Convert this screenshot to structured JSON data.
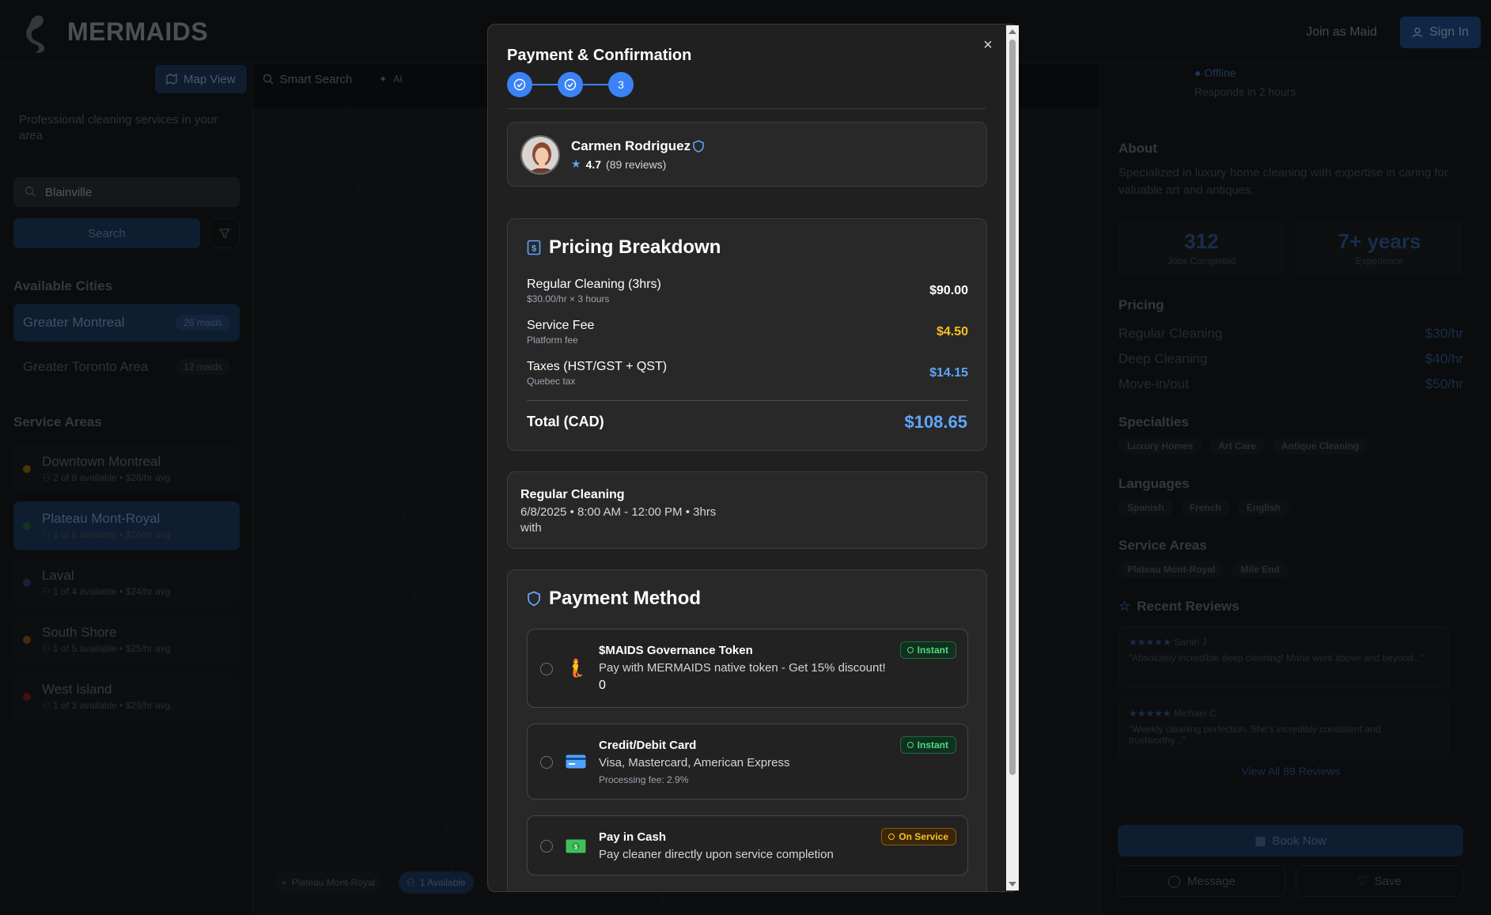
{
  "app": {
    "brand": "MERMAIDS",
    "join_label": "Join as Maid",
    "signin_label": "Sign In"
  },
  "view_tabs": [
    {
      "label": "Map View"
    },
    {
      "label": "Smart Search"
    },
    {
      "label": "AI"
    }
  ],
  "sidebar": {
    "tagline": "Professional cleaning services in your area",
    "search_value": "Blainville",
    "search_button": "Search",
    "cities_heading": "Available Cities",
    "cities": [
      {
        "name": "Greater Montreal",
        "badge": "26 maids"
      },
      {
        "name": "Greater Toronto Area",
        "badge": "12 maids"
      }
    ],
    "areas_heading": "Service Areas",
    "areas": [
      {
        "name": "Downtown Montreal",
        "available": "2 of 8 available",
        "rate": "$28/hr avg",
        "color": "#8a6d1c"
      },
      {
        "name": "Plateau Mont-Royal",
        "available": "1 of 6 available",
        "rate": "$26/hr avg",
        "color": "#1f6b3a"
      },
      {
        "name": "Laval",
        "available": "1 of 4 available",
        "rate": "$24/hr avg",
        "color": "#3b3a7a"
      },
      {
        "name": "South Shore",
        "available": "1 of 5 available",
        "rate": "$25/hr avg",
        "color": "#8a5a1c"
      },
      {
        "name": "West Island",
        "available": "1 of 3 available",
        "rate": "$29/hr avg",
        "color": "#7a2424"
      }
    ]
  },
  "map": {
    "pill_area": "Plateau Mont-Royal",
    "pill_available": "1 Available"
  },
  "profile": {
    "status": "Offline",
    "responds": "Responds in 2 hours",
    "about_heading": "About",
    "about_text": "Specialized in luxury home cleaning with expertise in caring for valuable art and antiques.",
    "stats": [
      {
        "value": "312",
        "label": "Jobs Completed"
      },
      {
        "value": "7+ years",
        "label": "Experience"
      }
    ],
    "pricing_heading": "Pricing",
    "pricing": [
      {
        "label": "Regular Cleaning",
        "value": "$30/hr"
      },
      {
        "label": "Deep Cleaning",
        "value": "$40/hr"
      },
      {
        "label": "Move-in/out",
        "value": "$50/hr"
      }
    ],
    "specialties_heading": "Specialties",
    "specialties": [
      "Luxury Homes",
      "Art Care",
      "Antique Cleaning"
    ],
    "languages_heading": "Languages",
    "languages": [
      "Spanish",
      "French",
      "English"
    ],
    "service_areas_heading": "Service Areas",
    "service_areas": [
      "Plateau Mont-Royal",
      "Mile End"
    ],
    "reviews_heading": "Recent Reviews",
    "reviews": [
      {
        "author": "Sarah J.",
        "stars": "★★★★★",
        "text": "\"Absolutely incredible deep cleaning! Marie went above and beyond...\""
      },
      {
        "author": "Michael C.",
        "stars": "★★★★★",
        "text": "\"Weekly cleaning perfection. She's incredibly consistent and trustworthy...\""
      }
    ],
    "view_all": "View All 89 Reviews",
    "book_label": "Book Now",
    "message_label": "Message",
    "save_label": "Save"
  },
  "modal": {
    "title": "Payment & Confirmation",
    "close_glyph": "×",
    "step3_label": "3",
    "cleaner": {
      "name": "Carmen Rodriguez",
      "rating": "4.7",
      "reviews": "(89 reviews)"
    },
    "pricing": {
      "title": "Pricing Breakdown",
      "items": [
        {
          "label": "Regular Cleaning (3hrs)",
          "sub": "$30.00/hr × 3 hours",
          "value": "$90.00",
          "color": "#ffffff"
        },
        {
          "label": "Service Fee",
          "sub": "Platform fee",
          "value": "$4.50",
          "color": "#fbbf24"
        },
        {
          "label": "Taxes (HST/GST + QST)",
          "sub": "Quebec tax",
          "value": "$14.15",
          "color": "#60a5fa"
        }
      ],
      "total_label": "Total (CAD)",
      "total_value": "$108.65"
    },
    "service": {
      "name": "Regular Cleaning",
      "when": "6/8/2025 • 8:00 AM - 12:00 PM • 3hrs",
      "with": "with"
    },
    "payment": {
      "title": "Payment Method",
      "options": [
        {
          "name": "$MAIDS Governance Token",
          "desc": "Pay with MERMAIDS native token - Get 15% discount!",
          "value": "0",
          "tag": "Instant",
          "icon": "mermaid-token-icon"
        },
        {
          "name": "Credit/Debit Card",
          "desc": "Visa, Mastercard, American Express",
          "extra": "Processing fee: 2.9%",
          "tag": "Instant",
          "icon": "credit-card-icon"
        },
        {
          "name": "Pay in Cash",
          "desc": "Pay cleaner directly upon service completion",
          "tag": "On Service",
          "icon": "cash-icon"
        }
      ]
    }
  }
}
